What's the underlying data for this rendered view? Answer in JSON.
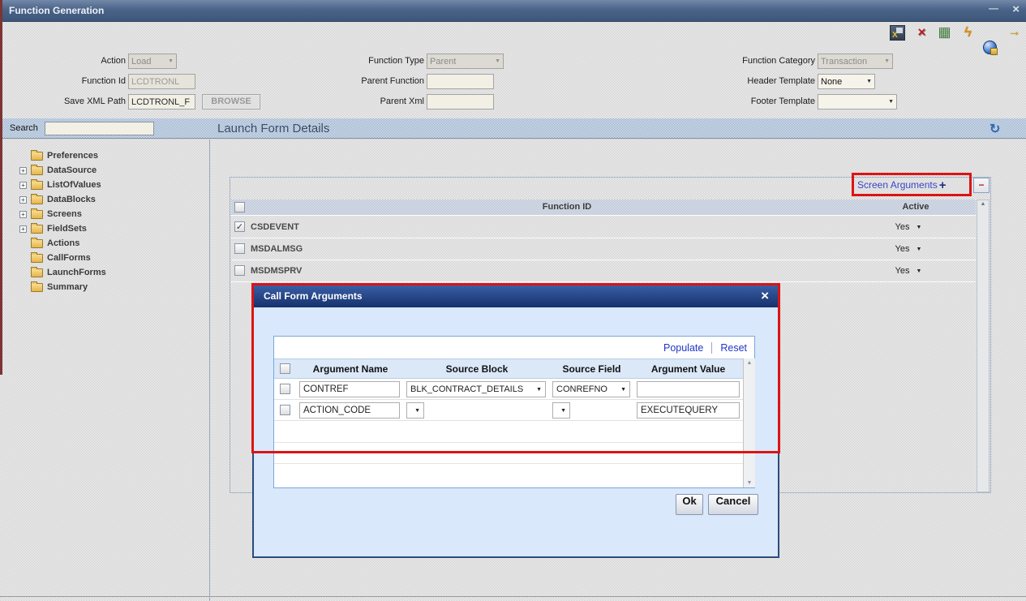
{
  "window": {
    "title": "Function Generation"
  },
  "icons": {
    "minimize": "—",
    "close": "×",
    "chevron_down": "▼",
    "chevron_up": "▲",
    "check": "✓",
    "plus": "+",
    "minus": "−",
    "refresh": "↻",
    "excel_x": "X",
    "delete_x": "×",
    "grid": "▦",
    "lightning": "ϟ",
    "arrow_right": "→",
    "expander_plus": "+"
  },
  "toolbar": {
    "icons": [
      "export-excel-icon",
      "delete-icon",
      "data-grid-icon",
      "generate-icon",
      "web-icon",
      "exit-icon"
    ]
  },
  "form": {
    "action": {
      "label": "Action",
      "value": "Load"
    },
    "function_type": {
      "label": "Function Type",
      "value": "Parent"
    },
    "function_category": {
      "label": "Function Category",
      "value": "Transaction"
    },
    "function_id": {
      "label": "Function Id",
      "value": "LCDTRONL"
    },
    "parent_function": {
      "label": "Parent Function",
      "value": ""
    },
    "header_template": {
      "label": "Header Template",
      "value": "None"
    },
    "save_xml_path": {
      "label": "Save XML Path",
      "value": "LCDTRONL_F",
      "browse_label": "BROWSE"
    },
    "parent_xml": {
      "label": "Parent Xml",
      "value": ""
    },
    "footer_template": {
      "label": "Footer Template",
      "value": ""
    }
  },
  "search": {
    "label": "Search",
    "value": "",
    "section_title": "Launch Form Details"
  },
  "sidebar": {
    "items": [
      {
        "label": "Preferences",
        "exp": ""
      },
      {
        "label": "DataSource",
        "exp": "+"
      },
      {
        "label": "ListOfValues",
        "exp": "+"
      },
      {
        "label": "DataBlocks",
        "exp": "+"
      },
      {
        "label": "Screens",
        "exp": "+"
      },
      {
        "label": "FieldSets",
        "exp": "+"
      },
      {
        "label": "Actions",
        "exp": ""
      },
      {
        "label": "CallForms",
        "exp": ""
      },
      {
        "label": "LaunchForms",
        "exp": ""
      },
      {
        "label": "Summary",
        "exp": ""
      }
    ]
  },
  "main_panel": {
    "screen_arguments_label": "Screen Arguments",
    "table": {
      "function_id_header": "Function ID",
      "active_header": "Active",
      "rows": [
        {
          "function_id": "CSDEVENT",
          "checked": "✓",
          "active": "Yes"
        },
        {
          "function_id": "MSDALMSG",
          "checked": "",
          "active": "Yes"
        },
        {
          "function_id": "MSDMSPRV",
          "checked": "",
          "active": "Yes"
        }
      ]
    }
  },
  "dialog": {
    "title": "Call Form Arguments",
    "populate": "Populate",
    "reset": "Reset",
    "columns": {
      "argument_name": "Argument Name",
      "source_block": "Source Block",
      "source_field": "Source Field",
      "argument_value": "Argument Value"
    },
    "rows": [
      {
        "checked": "",
        "argument_name": "CONTREF",
        "source_block": "BLK_CONTRACT_DETAILS",
        "source_field": "CONREFNO",
        "argument_value": ""
      },
      {
        "checked": "",
        "argument_name": "ACTION_CODE",
        "source_block": "",
        "source_field": "",
        "argument_value": "EXECUTEQUERY"
      }
    ],
    "ok": "Ok",
    "cancel": "Cancel"
  },
  "colors": {
    "annotation_red": "#dc1414",
    "link_blue": "#2036c8",
    "window_titlebar": "#4a6389",
    "dialog_titlebar": "#16316b",
    "dialog_body": "#d9e8fa"
  }
}
